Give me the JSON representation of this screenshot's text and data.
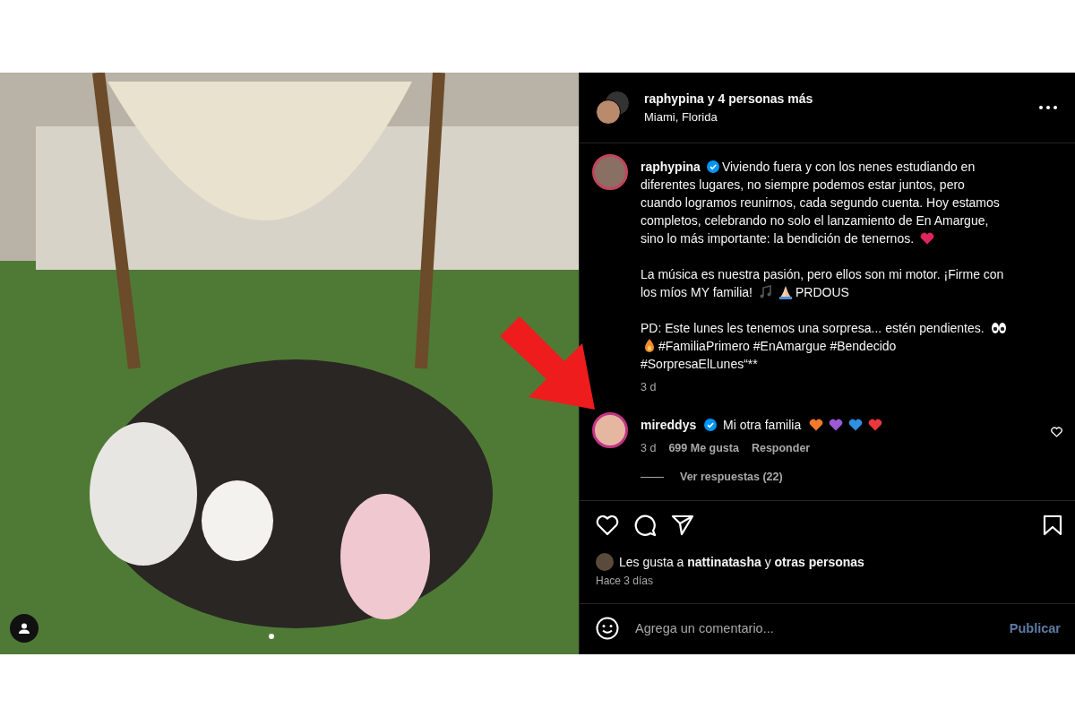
{
  "photo": {
    "tagged_people": true,
    "carousel_dots": [
      {
        "selected": true
      }
    ]
  },
  "header": {
    "title": "raphypina y 4 personas más",
    "location": "Miami, Florida"
  },
  "caption": {
    "username": "raphypina",
    "verified": true,
    "paragraphs": [
      {
        "lines": [
          {
            "segments": [
              {
                "kind": "text",
                "text": "Viviendo fuera y con los nenes estudiando en"
              }
            ]
          },
          {
            "segments": [
              {
                "kind": "text",
                "text": "diferentes lugares, no siempre podemos estar juntos, pero"
              }
            ]
          },
          {
            "segments": [
              {
                "kind": "text",
                "text": "cuando logramos reunirnos, cada segundo cuenta. Hoy estamos"
              }
            ]
          },
          {
            "segments": [
              {
                "kind": "text",
                "text": "completos, celebrando no solo el lanzamiento de En Amargue,"
              }
            ]
          },
          {
            "segments": [
              {
                "kind": "text",
                "text": "sino lo más importante: la bendición de tenernos."
              },
              {
                "kind": "heart",
                "color": "#e0245e"
              }
            ]
          }
        ]
      },
      {
        "lines": [
          {
            "segments": [
              {
                "kind": "text",
                "text": "La música es nuestra pasión, pero ellos son mi motor. ¡Firme con"
              }
            ]
          },
          {
            "segments": [
              {
                "kind": "text",
                "text": "los míos MY familia!"
              },
              {
                "kind": "music"
              },
              {
                "kind": "pray"
              },
              {
                "kind": "text",
                "text": "PRDOUS"
              }
            ]
          }
        ]
      },
      {
        "lines": [
          {
            "segments": [
              {
                "kind": "text",
                "text": "PD: Este lunes les tenemos una sorpresa... estén pendientes."
              },
              {
                "kind": "eyes"
              }
            ]
          },
          {
            "segments": [
              {
                "kind": "fire"
              },
              {
                "kind": "text",
                "text": "#FamiliaPrimero #EnAmargue #Bendecido"
              }
            ]
          },
          {
            "segments": [
              {
                "kind": "text",
                "text": "#SorpresaElLunes“**"
              }
            ]
          }
        ]
      }
    ],
    "time": "3 d"
  },
  "comment": {
    "username": "mireddys",
    "verified": true,
    "text": "Mi otra familia",
    "hearts": [
      {
        "color": "#f4792b"
      },
      {
        "color": "#9b59d6"
      },
      {
        "color": "#2f8fe0"
      },
      {
        "color": "#e8383d"
      }
    ],
    "time": "3 d",
    "likes": "699 Me gusta",
    "reply": "Responder",
    "view_replies": "Ver respuestas (22)",
    "liked": false
  },
  "actions": {
    "liked": false,
    "saved": false
  },
  "likes_line": "Les gusta a **nattinatasha** y **otras personas**",
  "date": "Hace 3 días",
  "composer": {
    "placeholder": "Agrega un comentario...",
    "submit": "Publicar"
  }
}
